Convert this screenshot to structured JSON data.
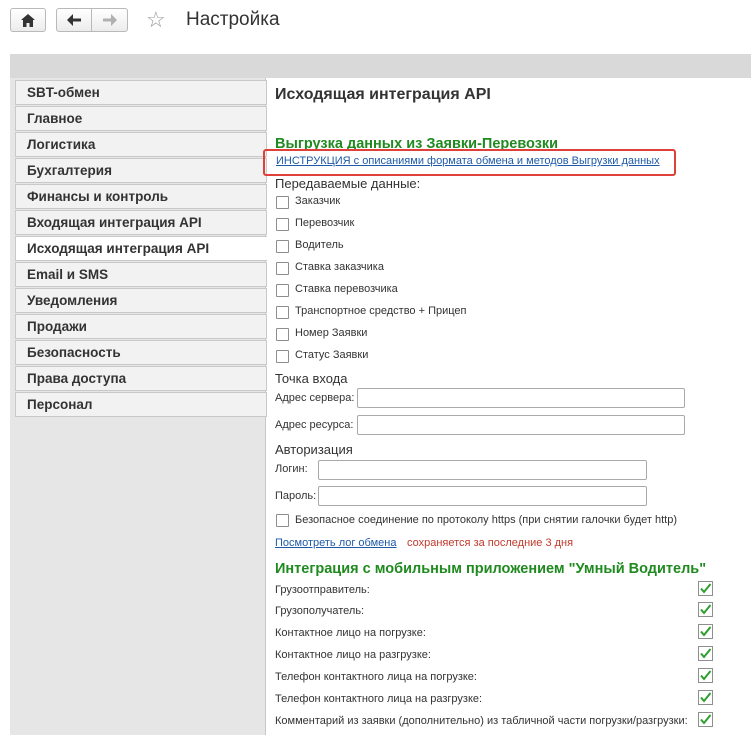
{
  "window": {
    "title": "Настройка"
  },
  "sidebar": {
    "items": [
      {
        "label": "SBT-обмен"
      },
      {
        "label": "Главное"
      },
      {
        "label": "Логистика"
      },
      {
        "label": "Бухгалтерия"
      },
      {
        "label": "Финансы и контроль"
      },
      {
        "label": "Входящая интеграция API"
      },
      {
        "label": "Исходящая интеграция API",
        "active": true
      },
      {
        "label": "Email и SMS"
      },
      {
        "label": "Уведомления"
      },
      {
        "label": "Продажи"
      },
      {
        "label": "Безопасность"
      },
      {
        "label": "Права доступа"
      },
      {
        "label": "Персонал"
      }
    ]
  },
  "main": {
    "title": "Исходящая интеграция API",
    "export_section_title": "Выгрузка данных из Заявки-Перевозки",
    "instruction_link": "ИНСТРУКЦИЯ с описаниями формата обмена  и методов Выгрузки данных",
    "transmitted_label": "Передаваемые данные:",
    "transmitted_items": [
      {
        "label": "Заказчик",
        "checked": false
      },
      {
        "label": "Перевозчик",
        "checked": false
      },
      {
        "label": "Водитель",
        "checked": false
      },
      {
        "label": "Ставка заказчика",
        "checked": false
      },
      {
        "label": "Ставка перевозчика",
        "checked": false
      },
      {
        "label": "Транспортное средство + Прицеп",
        "checked": false
      },
      {
        "label": "Номер Заявки",
        "checked": false
      },
      {
        "label": "Статус Заявки",
        "checked": false
      }
    ],
    "entry_point_label": "Точка входа",
    "server_address_label": "Адрес сервера:",
    "server_address_value": "",
    "resource_address_label": "Адрес ресурса:",
    "resource_address_value": "",
    "auth_label": "Авторизация",
    "login_label": "Логин:",
    "login_value": "",
    "password_label": "Пароль:",
    "password_value": "",
    "https_label": "Безопасное соединение по протоколу https (при снятии галочки будет http)",
    "https_checked": false,
    "log_link": "Посмотреть лог обмена",
    "log_note": "сохраняется за последние 3 дня",
    "mobile_section_title": "Интеграция с мобильным приложением \"Умный Водитель\"",
    "mobile_items": [
      {
        "label": "Грузоотправитель:",
        "checked": true
      },
      {
        "label": "Грузополучатель:",
        "checked": true
      },
      {
        "label": "Контактное лицо на погрузке:",
        "checked": true
      },
      {
        "label": "Контактное лицо на разгрузке:",
        "checked": true
      },
      {
        "label": "Телефон контактного лица на погрузке:",
        "checked": true
      },
      {
        "label": "Телефон контактного лица на разгрузке:",
        "checked": true
      },
      {
        "label": "Комментарий из заявки (дополнительно) из табличной части погрузки/разгрузки:",
        "checked": true
      }
    ]
  },
  "colors": {
    "section_green": "#1f8a1f",
    "link_blue": "#1e5aa8",
    "highlight_red": "#e0403a",
    "note_red": "#c0392b",
    "check_green": "#2e9e2e"
  },
  "icons": {
    "home": "home-icon",
    "back": "arrow-left-icon",
    "forward": "arrow-right-icon",
    "favorite": "star-icon",
    "checkmark": "checkmark-icon"
  }
}
